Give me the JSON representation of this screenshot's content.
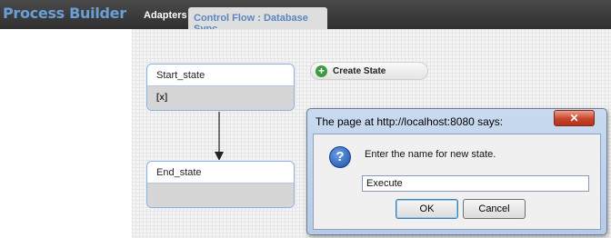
{
  "app": {
    "title": "Process Builder"
  },
  "tabs": [
    {
      "label": "Adapters",
      "active": false
    },
    {
      "label": "Control Flow : Database Sync",
      "active": true
    }
  ],
  "states": [
    {
      "name": "Start_state",
      "body": "[x]"
    },
    {
      "name": "End_state",
      "body": ""
    }
  ],
  "toolbar": {
    "create_state_label": "Create State"
  },
  "dialog": {
    "title": "The page at http://localhost:8080 says:",
    "close_symbol": "✕",
    "icon_symbol": "?",
    "message": "Enter the name for new state.",
    "input_value": "Execute",
    "ok_label": "OK",
    "cancel_label": "Cancel"
  },
  "colors": {
    "header_bg": "#3a3a3a",
    "app_title": "#6a9fd6",
    "active_tab_text": "#5a86c0",
    "state_border": "#8db0dc",
    "close_button": "#c8452c",
    "create_icon": "#3e9a3e"
  }
}
